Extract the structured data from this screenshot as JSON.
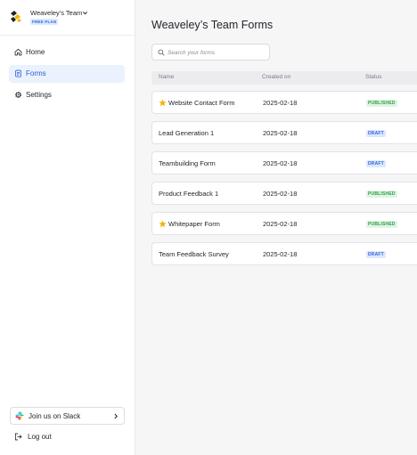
{
  "sidebar": {
    "team_name": "Weaveley's Team",
    "plan": "FREE PLAN",
    "nav": [
      {
        "label": "Home",
        "icon": "home-icon"
      },
      {
        "label": "Forms",
        "icon": "forms-icon",
        "active": true
      },
      {
        "label": "Settings",
        "icon": "gear-icon"
      }
    ],
    "slack_label": "Join us on Slack",
    "logout_label": "Log out"
  },
  "main": {
    "title": "Weaveley’s Team Forms",
    "search_placeholder": "Search your forms",
    "columns": {
      "name": "Name",
      "created": "Created on",
      "status": "Status"
    },
    "rows": [
      {
        "name": "Website Contact Form",
        "created": "2025-02-18",
        "status": "PUBLISHED",
        "starred": true
      },
      {
        "name": "Lead Generation 1",
        "created": "2025-02-18",
        "status": "DRAFT",
        "starred": false
      },
      {
        "name": "Teambuilding Form",
        "created": "2025-02-18",
        "status": "DRAFT",
        "starred": false
      },
      {
        "name": "Product Feedback 1",
        "created": "2025-02-18",
        "status": "PUBLISHED",
        "starred": false
      },
      {
        "name": "Whitepaper Form",
        "created": "2025-02-18",
        "status": "PUBLISHED",
        "starred": true
      },
      {
        "name": "Team Feedback Survey",
        "created": "2025-02-18",
        "status": "DRAFT",
        "starred": false
      }
    ]
  },
  "colors": {
    "accent": "#2a5bd7",
    "active_nav_bg": "#eaf2fe",
    "published_bg": "#dff5e3",
    "published_text": "#2e9d4a",
    "draft_bg": "#dbe8ff",
    "draft_text": "#3566d6",
    "star": "#f5b301"
  }
}
